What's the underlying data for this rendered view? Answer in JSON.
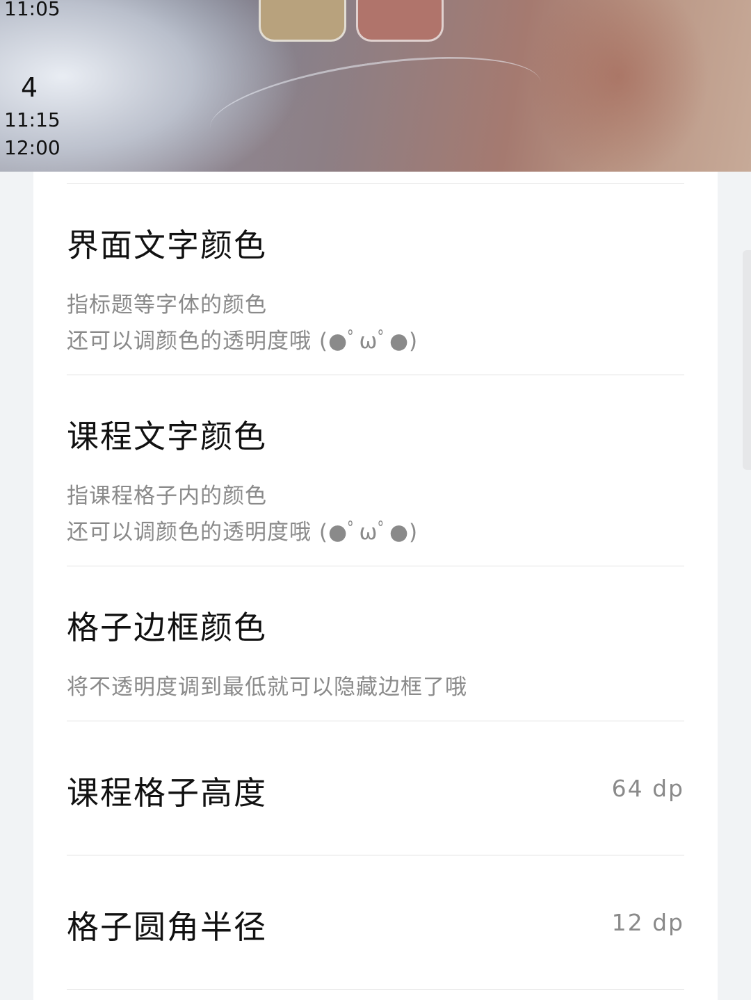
{
  "preview": {
    "times": [
      "11:05",
      "11:15",
      "12:00"
    ],
    "period_number": "4",
    "swatch_colors": [
      "#b8a27d",
      "#b0746b"
    ]
  },
  "settings": [
    {
      "title": "界面文字颜色",
      "desc_line1": "指标题等字体的颜色",
      "desc_line2": "还可以调颜色的透明度哦 (●ﾟωﾟ●)"
    },
    {
      "title": "课程文字颜色",
      "desc_line1": "指课程格子内的颜色",
      "desc_line2": "还可以调颜色的透明度哦 (●ﾟωﾟ●)"
    },
    {
      "title": "格子边框颜色",
      "desc_line1": "将不透明度调到最低就可以隐藏边框了哦"
    },
    {
      "title": "课程格子高度",
      "value": "64 dp"
    },
    {
      "title": "格子圆角半径",
      "value": "12 dp"
    }
  ]
}
